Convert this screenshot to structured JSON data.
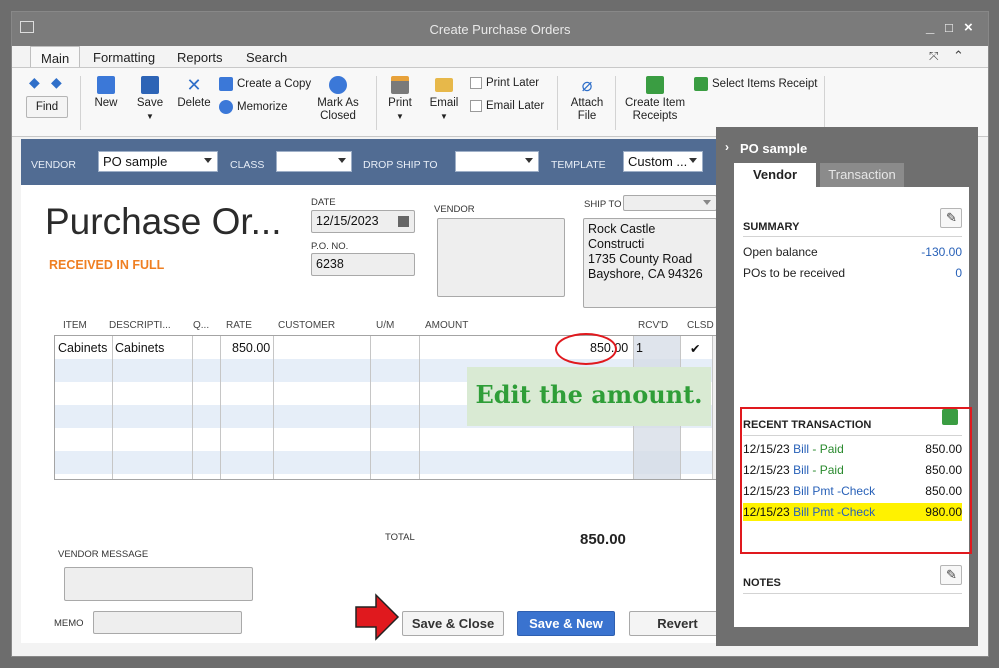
{
  "window": {
    "title": "Create Purchase Orders"
  },
  "ribbon_tabs": [
    "Main",
    "Formatting",
    "Reports",
    "Search"
  ],
  "toolbar": {
    "find": "Find",
    "new": "New",
    "save": "Save",
    "delete": "Delete",
    "create_copy": "Create a Copy",
    "memorize": "Memorize",
    "mark_as_closed_1": "Mark As",
    "mark_as_closed_2": "Closed",
    "print": "Print",
    "email": "Email",
    "print_later": "Print Later",
    "email_later": "Email Later",
    "attach_file_1": "Attach",
    "attach_file_2": "File",
    "create_item_receipts_1": "Create Item",
    "create_item_receipts_2": "Receipts",
    "select_items_receipt": "Select Items Receipt"
  },
  "header": {
    "vendor_label": "VENDOR",
    "vendor_value": "PO sample",
    "class_label": "CLASS",
    "class_value": "",
    "drop_ship_label": "DROP SHIP TO",
    "drop_ship_value": "",
    "template_label": "TEMPLATE",
    "template_value": "Custom ..."
  },
  "form": {
    "title": "Purchase Or...",
    "status": "RECEIVED IN FULL",
    "date_label": "DATE",
    "date_value": "12/15/2023",
    "po_label": "P.O. NO.",
    "po_value": "6238",
    "vendor_label": "VENDOR",
    "ship_to_label": "SHIP TO",
    "ship_to_lines": [
      "Rock Castle Constructi",
      "1735 County Road",
      "Bayshore, CA 94326"
    ]
  },
  "table": {
    "columns": [
      "ITEM",
      "DESCRIPTI...",
      "Q...",
      "RATE",
      "CUSTOMER",
      "U/M",
      "AMOUNT",
      "RCV'D",
      "CLSD"
    ],
    "rows": [
      {
        "item": "Cabinets",
        "description": "Cabinets",
        "qty": "",
        "rate": "850.00",
        "customer": "",
        "um": "",
        "amount": "850.00",
        "rcvd": "1",
        "clsd": "✔"
      }
    ]
  },
  "annotation": {
    "text": "Edit the amount."
  },
  "footer": {
    "total_label": "TOTAL",
    "total_value": "850.00",
    "vendor_message_label": "VENDOR MESSAGE",
    "memo_label": "MEMO",
    "save_close": "Save & Close",
    "save_new": "Save & New",
    "revert": "Revert"
  },
  "sidebar": {
    "title": "PO sample",
    "tabs": [
      "Vendor",
      "Transaction"
    ],
    "summary_label": "SUMMARY",
    "open_balance_label": "Open balance",
    "open_balance_value": "-130.00",
    "pos_received_label": "POs to be received",
    "pos_received_value": "0",
    "recent_label": "RECENT TRANSACTION",
    "recent": [
      {
        "date": "12/15/23",
        "type": "Bill",
        "status": "- Paid",
        "amount": "850.00"
      },
      {
        "date": "12/15/23",
        "type": "Bill",
        "status": "- Paid",
        "amount": "850.00"
      },
      {
        "date": "12/15/23",
        "type": "Bill Pmt -Check",
        "status": "",
        "amount": "850.00"
      },
      {
        "date": "12/15/23",
        "type": "Bill Pmt -Check",
        "status": "",
        "amount": "980.00"
      }
    ],
    "notes_label": "NOTES"
  },
  "colors": {
    "header_bg": "#516c93",
    "status_orange": "#ef7f22",
    "link_blue": "#2861b8",
    "highlight": "#fff200",
    "annotation_red": "#e0191e"
  }
}
